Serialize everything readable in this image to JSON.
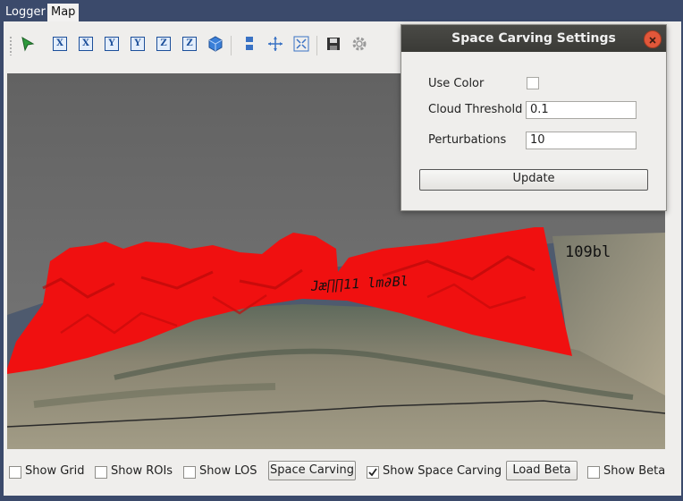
{
  "tabs": [
    {
      "label": "Logger"
    },
    {
      "label": "Map"
    }
  ],
  "toolbar": {
    "axis_buttons": [
      "X",
      "X",
      "Y",
      "Y",
      "Z",
      "Z"
    ]
  },
  "dialog": {
    "title": "Space Carving Settings",
    "use_color_label": "Use Color",
    "use_color_checked": false,
    "cloud_threshold_label": "Cloud Threshold",
    "cloud_threshold_value": "0.1",
    "perturbations_label": "Perturbations",
    "perturbations_value": "10",
    "update_label": "Update"
  },
  "viewport": {
    "text_overlay_left": "Jæ∏∏11 lm∂Bl",
    "text_overlay_right": "109bl"
  },
  "bottom": {
    "show_grid": {
      "label": "Show Grid",
      "checked": false
    },
    "show_rois": {
      "label": "Show ROIs",
      "checked": false
    },
    "show_los": {
      "label": "Show LOS",
      "checked": false
    },
    "space_carving_button": "Space Carving",
    "show_space_carving": {
      "label": "Show Space Carving",
      "checked": true
    },
    "load_beta_button": "Load Beta",
    "show_beta": {
      "label": "Show Beta",
      "checked": false
    }
  },
  "colors": {
    "window_bg": "#3b4a6b",
    "carving_red": "#f01010",
    "dialog_title_bg": "#3f3f3b",
    "close_button": "#e2573a"
  }
}
